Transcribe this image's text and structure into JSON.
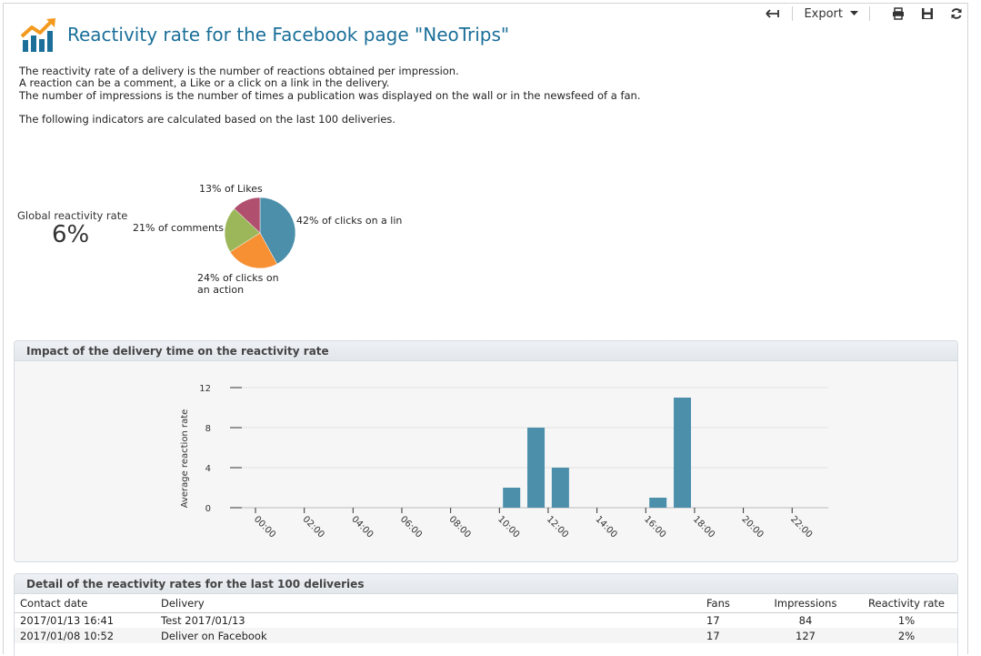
{
  "toolbar": {
    "back_icon": "back-arrow-icon",
    "export_label": "Export",
    "icons": [
      "print-icon",
      "save-icon",
      "refresh-icon"
    ]
  },
  "header": {
    "title": "Reactivity rate for the Facebook page \"NeoTrips\"",
    "logo_icon": "rising-chart-icon"
  },
  "intro": {
    "line1": "The reactivity rate of a delivery is the number of reactions obtained per impression.",
    "line2": "A reaction can be a comment, a Like or a click on a link in the delivery.",
    "line3": "The number of impressions is the number of times a publication was displayed on the wall or in the newsfeed of a fan.",
    "line4": "The following indicators are calculated based on the last 100 deliveries."
  },
  "global": {
    "label": "Global reactivity rate",
    "value": "6%"
  },
  "pie": {
    "colors": {
      "likes": "#b0506e",
      "comments": "#9cb65a",
      "action": "#f78f33",
      "link": "#4b8fab"
    },
    "labels": {
      "likes": "13% of Likes",
      "comments": "21% of comments",
      "link": "42% of clicks on a lin",
      "action_line1": "24% of clicks on",
      "action_line2": "an action"
    }
  },
  "impact_panel": {
    "title": "Impact of the delivery time on the reactivity rate"
  },
  "detail_panel": {
    "title": "Detail of the reactivity rates for the last 100 deliveries",
    "columns": [
      "Contact date",
      "Delivery",
      "Fans",
      "Impressions",
      "Reactivity rate"
    ],
    "rows": [
      {
        "date": "2017/01/13 16:41",
        "delivery": "Test 2017/01/13",
        "fans": "17",
        "impressions": "84",
        "rate": "1%"
      },
      {
        "date": "2017/01/08 10:52",
        "delivery": "Deliver on Facebook",
        "fans": "17",
        "impressions": "127",
        "rate": "2%"
      }
    ]
  },
  "chart_data": [
    {
      "type": "pie",
      "title": "",
      "slices": [
        {
          "label": "42% of clicks on a lin",
          "value": 42,
          "color": "#4b8fab"
        },
        {
          "label": "24% of clicks on an action",
          "value": 24,
          "color": "#f78f33"
        },
        {
          "label": "21% of comments",
          "value": 21,
          "color": "#9cb65a"
        },
        {
          "label": "13% of Likes",
          "value": 13,
          "color": "#b0506e"
        }
      ]
    },
    {
      "type": "bar",
      "title": "Impact of the delivery time on the reactivity rate",
      "xlabel": "",
      "ylabel": "Average reaction rate",
      "ylim": [
        0,
        12
      ],
      "yticks": [
        0,
        4,
        8,
        12
      ],
      "xticks": [
        "00:00",
        "02:00",
        "04:00",
        "06:00",
        "08:00",
        "10:00",
        "12:00",
        "14:00",
        "16:00",
        "18:00",
        "20:00",
        "22:00"
      ],
      "x": [
        10,
        11,
        12,
        16,
        17
      ],
      "values": [
        2,
        8,
        4,
        1,
        11
      ],
      "color": "#4b8fab",
      "grid": true
    }
  ]
}
